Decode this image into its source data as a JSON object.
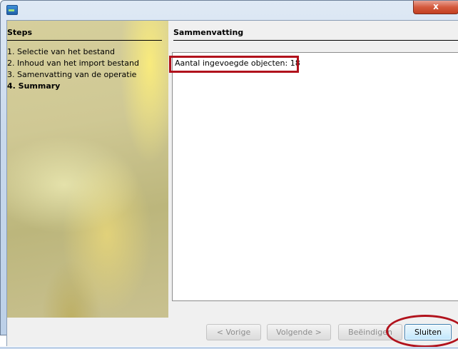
{
  "window": {
    "close_glyph": "x",
    "icon": "app-icon"
  },
  "steps": {
    "title": "Steps",
    "items": [
      {
        "label": "1. Selectie van het bestand",
        "current": false
      },
      {
        "label": "2. Inhoud van het import bestand",
        "current": false
      },
      {
        "label": "3. Samenvatting van de operatie",
        "current": false
      },
      {
        "label": "4. Summary",
        "current": true
      }
    ]
  },
  "main": {
    "title": "Sammenvatting",
    "result_text": "Aantal ingevoegde objecten: 18"
  },
  "buttons": {
    "previous": "< Vorige",
    "next": "Volgende >",
    "finish": "Beëindigen",
    "close": "Sluiten"
  },
  "annotation_color": "#b1121c"
}
